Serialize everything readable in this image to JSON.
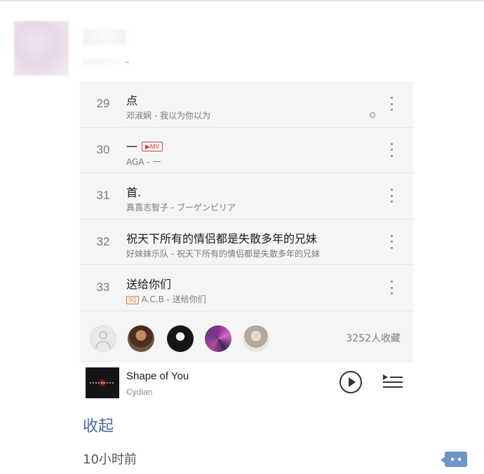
{
  "songs": [
    {
      "num": "29",
      "title": "点",
      "subtitle": "邓淑娴 - 我以为你以为"
    },
    {
      "num": "30",
      "title": "一",
      "badge": "▶MV",
      "subtitle": "AGA - 一"
    },
    {
      "num": "31",
      "title": "首.",
      "subtitle": "真喜志智子 - ブーゲンビリア"
    },
    {
      "num": "32",
      "title": "祝天下所有的情侣都是失散多年的兄妹",
      "subtitle": "好妹妹乐队 - 祝天下所有的情侣都是失散多年的兄妹"
    },
    {
      "num": "33",
      "title": "送给你们",
      "badge": "SQ",
      "subtitle": "A.C.B - 送给你们"
    }
  ],
  "fans": {
    "count_text": "3252人收藏"
  },
  "player": {
    "title": "Shape of You",
    "artist": "Cydian"
  },
  "post": {
    "collapse_label": "收起",
    "time": "10小时前"
  },
  "icons": {
    "more": "more-vertical-icon",
    "play": "play-icon",
    "playlist": "playlist-icon",
    "comment": "comment-icon",
    "avatar_placeholder": "user-icon"
  },
  "colors": {
    "link": "#4d6a9c",
    "mv_badge": "#e03a3a",
    "sq_badge": "#e8772e",
    "comment_icon": "#6d95c7"
  }
}
